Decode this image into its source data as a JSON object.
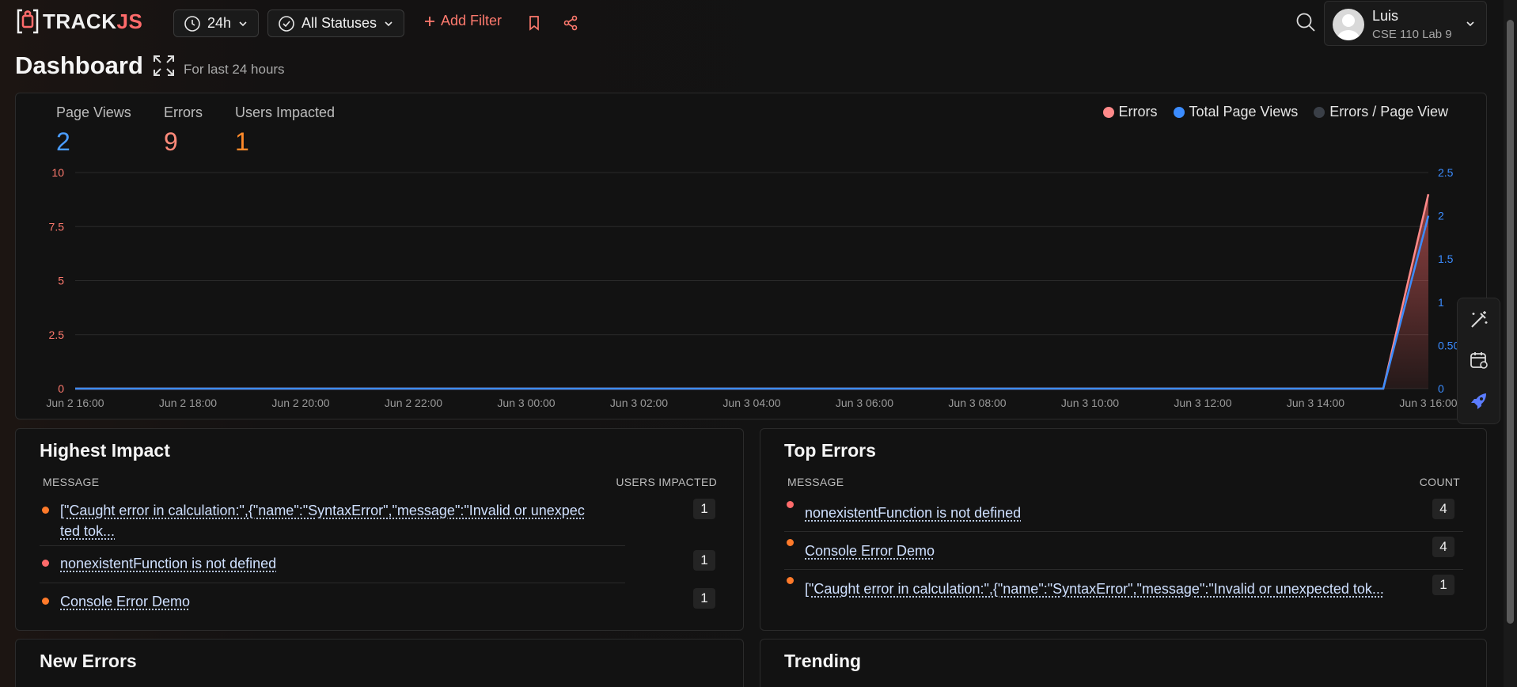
{
  "brand": {
    "name_a": "TRACK",
    "name_b": "JS"
  },
  "toolbar": {
    "time_range": "24h",
    "status_filter": "All Statuses",
    "add_filter": "Add Filter"
  },
  "user": {
    "name": "Luis",
    "app": "CSE 110 Lab 9"
  },
  "header": {
    "title": "Dashboard",
    "subtitle": "For last 24 hours"
  },
  "stats": [
    {
      "label": "Page Views",
      "value": "2",
      "color": "#4a9cff"
    },
    {
      "label": "Errors",
      "value": "9",
      "color": "#ff8a7a"
    },
    {
      "label": "Users Impacted",
      "value": "1",
      "color": "#ff8a2a"
    }
  ],
  "legend": [
    {
      "label": "Errors",
      "color": "#ff8a8a"
    },
    {
      "label": "Total Page Views",
      "color": "#3b8cff"
    },
    {
      "label": "Errors / Page View",
      "color": "#3a3f47"
    }
  ],
  "chart_data": {
    "type": "area",
    "x": [
      "Jun 2 16:00",
      "Jun 2 18:00",
      "Jun 2 20:00",
      "Jun 2 22:00",
      "Jun 3 00:00",
      "Jun 3 02:00",
      "Jun 3 04:00",
      "Jun 3 06:00",
      "Jun 3 08:00",
      "Jun 3 10:00",
      "Jun 3 12:00",
      "Jun 3 14:00",
      "Jun 3 16:00"
    ],
    "y_left_ticks": [
      "0",
      "2.5",
      "5",
      "7.5",
      "10"
    ],
    "y_right_ticks": [
      "0",
      "0.50",
      "1",
      "1.5",
      "2",
      "2.5"
    ],
    "ylim_left": [
      0,
      10
    ],
    "ylim_right": [
      0,
      2.5
    ],
    "series": [
      {
        "name": "Errors",
        "axis": "left",
        "color": "#ff8a8a",
        "points": [
          [
            0,
            0
          ],
          [
            23.2,
            0
          ],
          [
            24,
            9
          ]
        ]
      },
      {
        "name": "Total Page Views",
        "axis": "right",
        "color": "#3b8cff",
        "points": [
          [
            0,
            0
          ],
          [
            23.2,
            0
          ],
          [
            24,
            2
          ]
        ]
      }
    ],
    "grid": true,
    "legend_position": "top-right"
  },
  "highest_impact": {
    "title": "Highest Impact",
    "col_message": "MESSAGE",
    "col_value": "USERS IMPACTED",
    "rows": [
      {
        "line1": "[\"Caught error in calculation:\",{\"name\":\"SyntaxError\",\"message\":\"Invalid or unexpec",
        "line2": "ted tok...",
        "value": "1",
        "color": "#ff7a2a"
      },
      {
        "line1": "nonexistentFunction is not defined",
        "line2": "",
        "value": "1",
        "color": "#ff6b6b"
      },
      {
        "line1": "Console Error Demo",
        "line2": "",
        "value": "1",
        "color": "#ff7a2a"
      }
    ]
  },
  "top_errors": {
    "title": "Top Errors",
    "col_message": "MESSAGE",
    "col_value": "COUNT",
    "rows": [
      {
        "line1": "nonexistentFunction is not defined",
        "value": "4",
        "color": "#ff6b6b"
      },
      {
        "line1": "Console Error Demo",
        "value": "4",
        "color": "#ff7a2a"
      },
      {
        "line1": "[\"Caught error in calculation:\",{\"name\":\"SyntaxError\",\"message\":\"Invalid or unexpected tok...",
        "value": "1",
        "color": "#ff7a2a"
      }
    ]
  },
  "new_errors": {
    "title": "New Errors"
  },
  "trending": {
    "title": "Trending"
  }
}
